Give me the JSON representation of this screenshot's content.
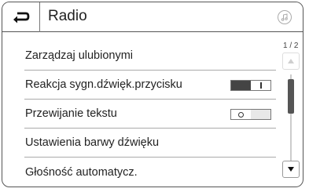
{
  "header": {
    "title": "Radio",
    "back_icon": "back-arrow-icon",
    "source_icon": "music-note-icon"
  },
  "menu": {
    "items": [
      {
        "label": "Zarządzaj ulubionymi",
        "control": "none"
      },
      {
        "label": "Reakcja sygn.dźwięk.przycisku",
        "control": "toggle",
        "state": "on"
      },
      {
        "label": "Przewijanie tekstu",
        "control": "toggle",
        "state": "off"
      },
      {
        "label": "Ustawienia barwy dźwięku",
        "control": "none"
      },
      {
        "label": "Głośność automatycz.",
        "control": "none"
      }
    ]
  },
  "scroll": {
    "page_indicator": "1 / 2",
    "current_page": 1,
    "total_pages": 2
  },
  "colors": {
    "border": "#555555",
    "toggle_on": "#444444",
    "scroll_thumb": "#555555"
  }
}
